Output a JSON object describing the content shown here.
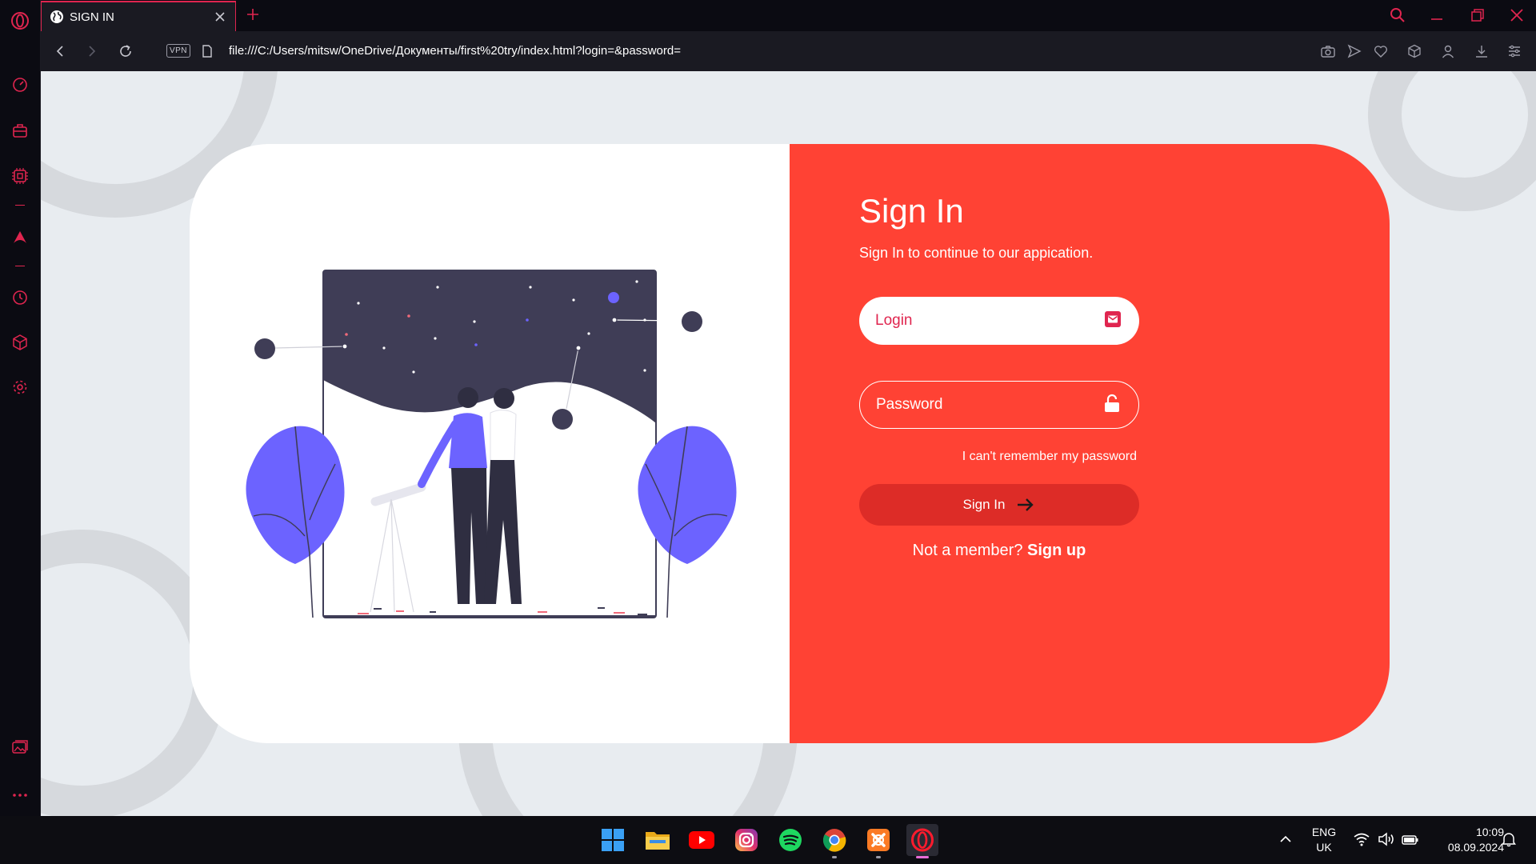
{
  "browser": {
    "tab_title": "SIGN IN",
    "vpn_label": "VPN",
    "url": "file:///C:/Users/mitsw/OneDrive/Документы/first%20try/index.html?login=&password="
  },
  "sidebar": {
    "items": [
      "opera-logo-icon",
      "speed-dial-icon",
      "briefcase-icon",
      "ai-chip-icon",
      "aria-icon",
      "history-icon",
      "cube-icon",
      "settings-icon",
      "gallery-icon",
      "more-icon"
    ]
  },
  "page": {
    "title": "Sign In",
    "subtitle": "Sign In to continue to our appication.",
    "login_placeholder": "Login",
    "password_placeholder": "Password",
    "forgot_link": "I can't remember my password",
    "signin_button": "Sign In",
    "member_text": "Not a member?",
    "signup_link": "Sign up",
    "accent_color": "#ff4234",
    "button_color": "#dd2c27",
    "brand_pink": "#e0254f"
  },
  "taskbar": {
    "apps": [
      "windows-start-icon",
      "file-explorer-icon",
      "youtube-icon",
      "instagram-icon",
      "spotify-icon",
      "chrome-icon",
      "xampp-icon",
      "opera-icon"
    ],
    "language_top": "ENG",
    "language_bottom": "UK",
    "time": "10:09",
    "date": "08.09.2024"
  }
}
